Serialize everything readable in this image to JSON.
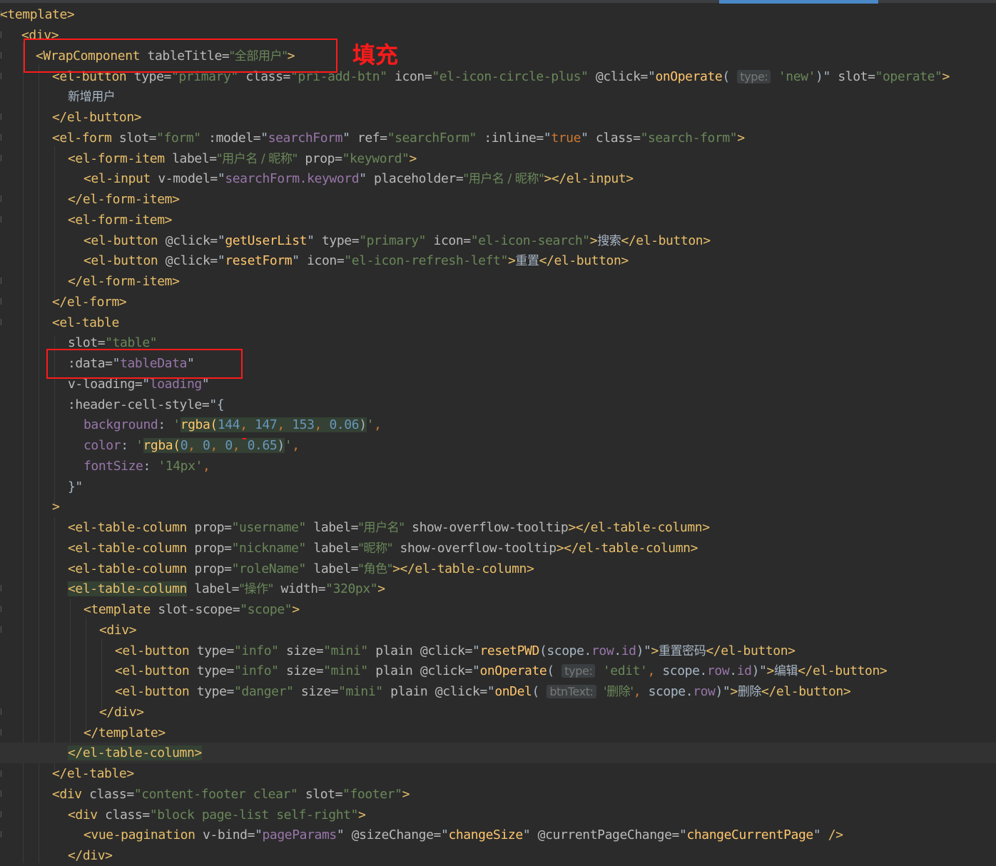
{
  "annotation": {
    "label": "填充"
  },
  "code": {
    "l01": "<template>",
    "l02": "<div>",
    "l03a": "<WrapComponent",
    "l03b": " tableTitle=",
    "l03c": "\"全部用户\"",
    "l03d": ">",
    "l04a": "<el-button",
    "l04b": " type=",
    "l04c": "\"primary\"",
    "l04d": " class=",
    "l04e": "\"pri-add-btn\"",
    "l04f": " icon=",
    "l04g": "\"el-icon-circle-plus\"",
    "l04h": " @click=",
    "l04i": "\"",
    "l04j": "onOperate",
    "l04k": "(",
    "l04l": "type:",
    "l04m": "'new'",
    "l04n": ")\"",
    "l04o": " slot=",
    "l04p": "\"operate\"",
    "l04q": ">",
    "l05": "新增用户",
    "l06": "</el-button>",
    "l07a": "<el-form",
    "l07b": " slot=",
    "l07c": "\"form\"",
    "l07d": " :model=",
    "l07e": "\"",
    "l07f": "searchForm",
    "l07g": "\"",
    "l07h": " ref=",
    "l07i": "\"searchForm\"",
    "l07j": " :inline=",
    "l07k": "\"",
    "l07l": "true",
    "l07m": "\"",
    "l07n": " class=",
    "l07o": "\"search-form\"",
    "l07p": ">",
    "l08a": "<el-form-item",
    "l08b": " label=",
    "l08c": "\"用户名 / 昵称\"",
    "l08d": " prop=",
    "l08e": "\"keyword\"",
    "l08f": ">",
    "l09a": "<el-input",
    "l09b": " v-model=",
    "l09c": "\"",
    "l09d": "searchForm.",
    "l09e": "keyword",
    "l09f": "\"",
    "l09g": " placeholder=",
    "l09h": "\"用户名 / 昵称\"",
    "l09i": "></el-input>",
    "l10": "</el-form-item>",
    "l11": "<el-form-item>",
    "l12a": "<el-button",
    "l12b": " @click=",
    "l12c": "\"",
    "l12d": "getUserList",
    "l12e": "\"",
    "l12f": " type=",
    "l12g": "\"primary\"",
    "l12h": " icon=",
    "l12i": "\"el-icon-search\"",
    "l12j": ">",
    "l12k": "搜索",
    "l12l": "</el-button>",
    "l13a": "<el-button",
    "l13b": " @click=",
    "l13c": "\"",
    "l13d": "resetForm",
    "l13e": "\"",
    "l13f": " icon=",
    "l13g": "\"el-icon-refresh-left\"",
    "l13h": ">",
    "l13i": "重置",
    "l13j": "</el-button>",
    "l14": "</el-form-item>",
    "l15": "</el-form>",
    "l16": "<el-table",
    "l17a": "slot=",
    "l17b": "\"table\"",
    "l18a": ":data=",
    "l18b": "\"",
    "l18c": "tableData",
    "l18d": "\"",
    "l19a": "v-loading=",
    "l19b": "\"",
    "l19c": "loading",
    "l19d": "\"",
    "l20a": ":header-cell-style=",
    "l20b": "\"{",
    "l21a": "background",
    "l21b": ": ",
    "l21c": "'",
    "l21d": "rgba(",
    "l21e": "144",
    "l21f": ", ",
    "l21g": "147",
    "l21h": ", ",
    "l21i": "153",
    "l21j": ", ",
    "l21k": "0.06",
    "l21l": ")",
    "l21m": "'",
    "l21n": ",",
    "l22a": "color",
    "l22b": ": ",
    "l22c": "'",
    "l22d": "rgba(",
    "l22e": "0",
    "l22f": ", ",
    "l22g": "0",
    "l22h": ", ",
    "l22i": "0",
    "l22j": ", ",
    "l22k": "0.65",
    "l22l": ")",
    "l22m": "'",
    "l22n": ",",
    "l23a": "fontSize",
    "l23b": ": ",
    "l23c": "'14px'",
    "l23d": ",",
    "l24": "}\"",
    "l25": ">",
    "l26a": "<el-table-column",
    "l26b": " prop=",
    "l26c": "\"username\"",
    "l26d": " label=",
    "l26e": "\"用户名\"",
    "l26f": " show-overflow-tooltip",
    "l26g": "></el-table-column>",
    "l27a": "<el-table-column",
    "l27b": " prop=",
    "l27c": "\"nickname\"",
    "l27d": " label=",
    "l27e": "\"昵称\"",
    "l27f": " show-overflow-tooltip",
    "l27g": "></el-table-column>",
    "l28a": "<el-table-column",
    "l28b": " prop=",
    "l28c": "\"roleName\"",
    "l28d": " label=",
    "l28e": "\"角色\"",
    "l28f": "></el-table-column>",
    "l29a": "<el-table-column",
    "l29b": " label=",
    "l29c": "\"操作\"",
    "l29d": " width=",
    "l29e": "\"320px\"",
    "l29f": ">",
    "l30a": "<template",
    "l30b": " slot-scope=",
    "l30c": "\"scope\"",
    "l30d": ">",
    "l31": "<div>",
    "l32a": "<el-button",
    "l32b": " type=",
    "l32c": "\"info\"",
    "l32d": " size=",
    "l32e": "\"mini\"",
    "l32f": " plain @click=",
    "l32g": "\"",
    "l32h": "resetPWD",
    "l32i": "(scope.",
    "l32j": "row",
    "l32k": ".",
    "l32l": "id",
    "l32m": ")\"",
    "l32n": ">",
    "l32o": "重置密码",
    "l32p": "</el-button>",
    "l33a": "<el-button",
    "l33b": " type=",
    "l33c": "\"info\"",
    "l33d": " size=",
    "l33e": "\"mini\"",
    "l33f": " plain @click=",
    "l33g": "\"",
    "l33h": "onOperate",
    "l33i": "(",
    "l33j": "type:",
    "l33k": "'edit'",
    "l33l": ", ",
    "l33m": "scope.",
    "l33n": "row",
    "l33o": ".",
    "l33p": "id",
    "l33q": ")\"",
    "l33r": ">",
    "l33s": "编辑",
    "l33t": "</el-button>",
    "l34a": "<el-button",
    "l34b": " type=",
    "l34c": "\"danger\"",
    "l34d": " size=",
    "l34e": "\"mini\"",
    "l34f": " plain @click=",
    "l34g": "\"",
    "l34h": "onDel",
    "l34i": "(",
    "l34j": "btnText:",
    "l34k": "'删除'",
    "l34l": ", ",
    "l34m": "scope.",
    "l34n": "row",
    "l34o": ")\"",
    "l34p": ">",
    "l34q": "删除",
    "l34r": "</el-button>",
    "l35": "</div>",
    "l36": "</template>",
    "l37": "</el-table-column>",
    "l38": "</el-table>",
    "l39a": "<div",
    "l39b": " class=",
    "l39c": "\"content-footer clear\"",
    "l39d": " slot=",
    "l39e": "\"footer\"",
    "l39f": ">",
    "l40a": "<div",
    "l40b": " class=",
    "l40c": "\"block page-list self-right\"",
    "l40d": ">",
    "l41a": "<vue-pagination",
    "l41b": " v-bind=",
    "l41c": "\"",
    "l41d": "pageParams",
    "l41e": "\"",
    "l41f": " @sizeChange=",
    "l41g": "\"",
    "l41h": "changeSize",
    "l41i": "\"",
    "l41j": " @currentPageChange=",
    "l41k": "\"",
    "l41l": "changeCurrentPage",
    "l41m": "\"",
    "l41n": " />",
    "l42": "</div>"
  }
}
